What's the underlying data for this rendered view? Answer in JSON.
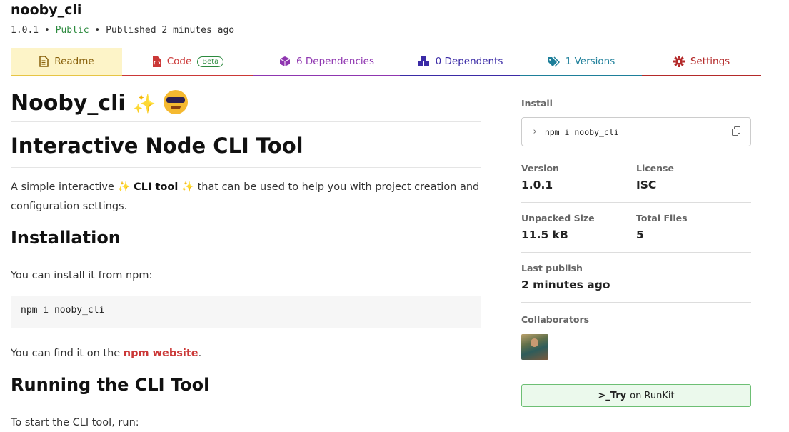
{
  "package": {
    "name": "nooby_cli",
    "version": "1.0.1",
    "visibility": "Public",
    "published": "Published 2 minutes ago"
  },
  "tabs": {
    "readme": "Readme",
    "code": "Code",
    "code_badge": "Beta",
    "dependencies": "6 Dependencies",
    "dependents": "0 Dependents",
    "versions": "1 Versions",
    "settings": "Settings"
  },
  "readme": {
    "title": "Nooby_cli",
    "subtitle": "Interactive Node CLI Tool",
    "intro_before": "A simple interactive",
    "intro_bold": "CLI tool",
    "intro_after": "that can be used to help you with project creation and configuration settings.",
    "installation_heading": "Installation",
    "install_text": "You can install it from npm:",
    "install_code": "npm i nooby_cli",
    "find_text": "You can find it on the",
    "npm_link": "npm website",
    "running_heading": "Running the CLI Tool",
    "start_text": "To start the CLI tool, run:"
  },
  "sidebar": {
    "install_label": "Install",
    "install_cmd": "npm i nooby_cli",
    "version_label": "Version",
    "version_value": "1.0.1",
    "license_label": "License",
    "license_value": "ISC",
    "unpacked_label": "Unpacked Size",
    "unpacked_value": "11.5 kB",
    "files_label": "Total Files",
    "files_value": "5",
    "last_publish_label": "Last publish",
    "last_publish_value": "2 minutes ago",
    "collaborators_label": "Collaborators",
    "runkit_prefix": ">_",
    "runkit_bold": "Try",
    "runkit_rest": "on RunKit"
  },
  "icons": {
    "readme": "document-icon",
    "code": "file-code-icon",
    "dependencies": "box-icon",
    "dependents": "boxes-icon",
    "versions": "tags-icon",
    "settings": "gear-icon",
    "copy": "copy-icon"
  },
  "colors": {
    "npm_red": "#cb3837",
    "public_green": "#2c8a3e",
    "readme_tab_bg": "#fdf4c8",
    "runkit_bg": "#ebf9ec"
  }
}
